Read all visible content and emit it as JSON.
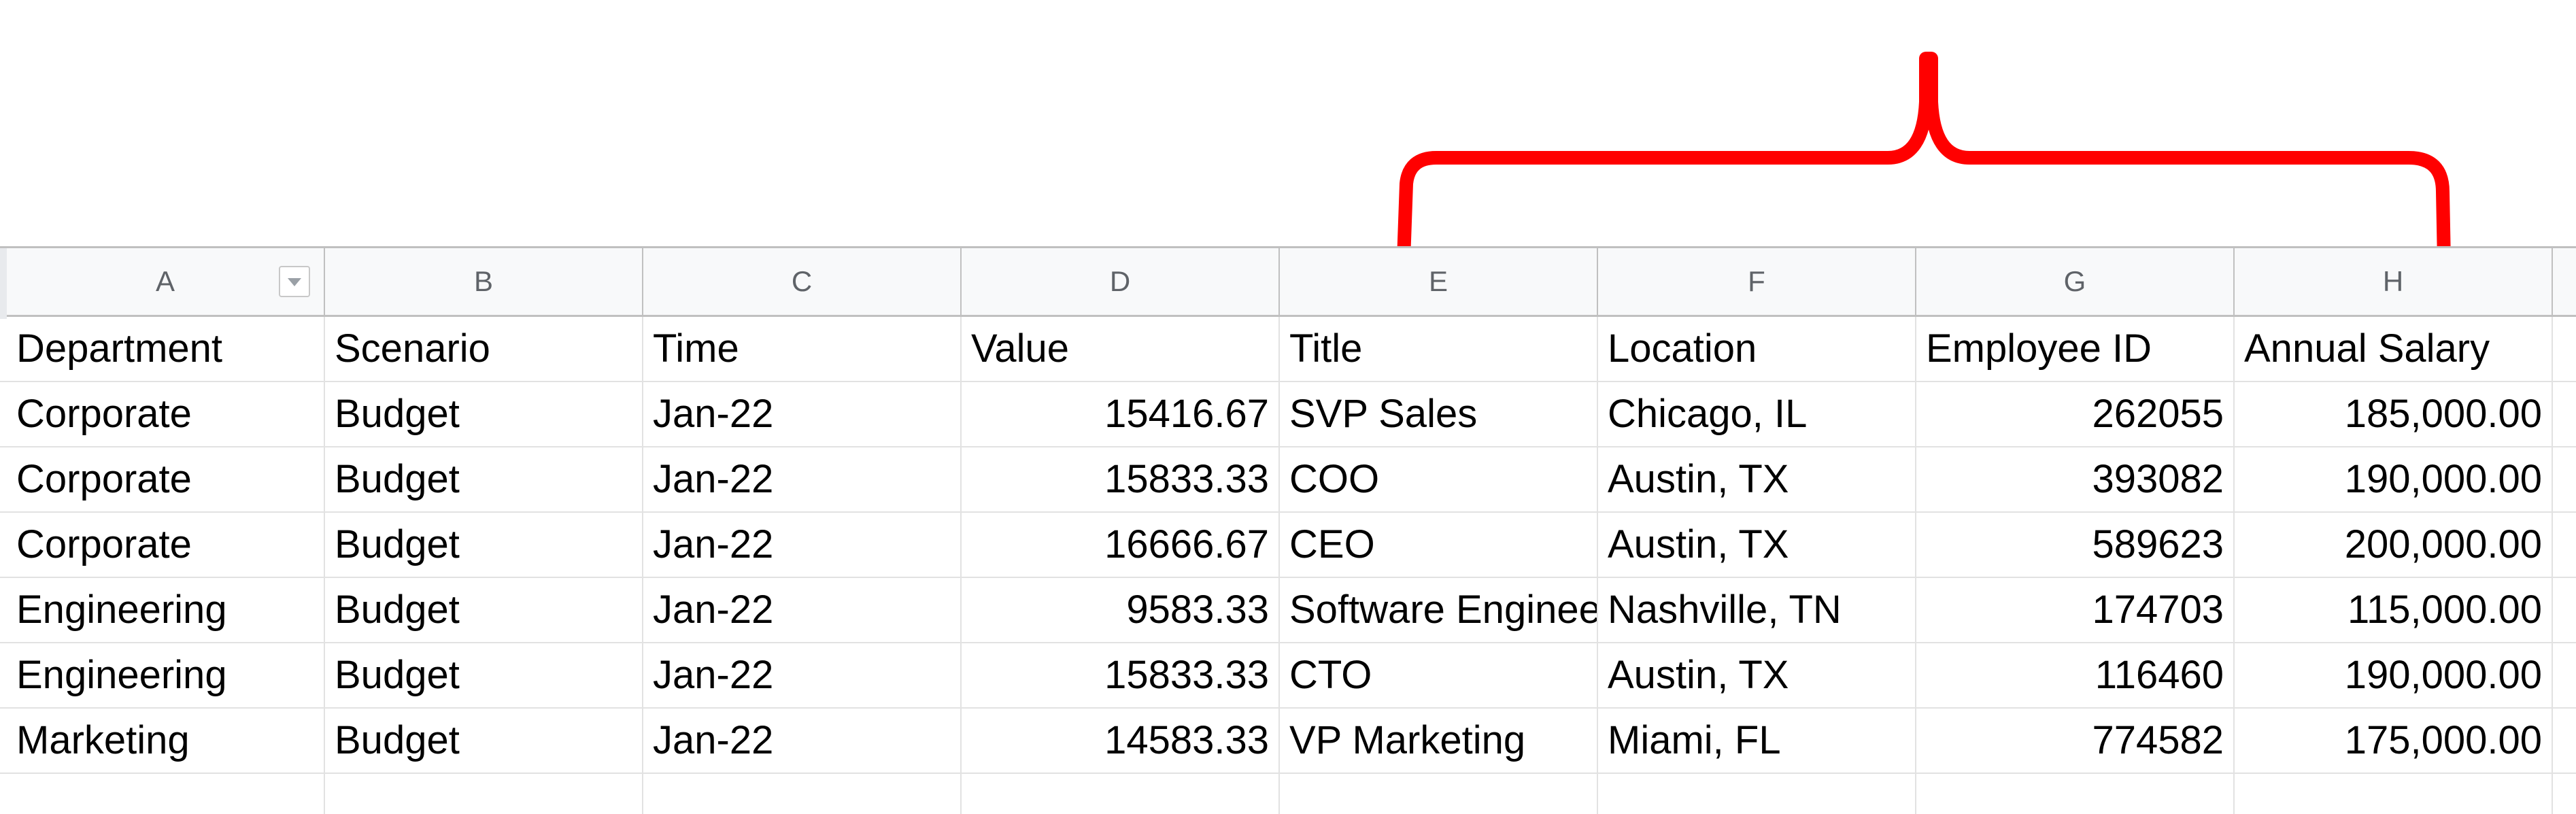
{
  "annotation": {
    "color": "#ff0000"
  },
  "columns": [
    "A",
    "B",
    "C",
    "D",
    "E",
    "F",
    "G",
    "H"
  ],
  "rows": [
    [
      "Department",
      "Scenario",
      "Time",
      "Value",
      "Title",
      "Location",
      "Employee ID",
      "Annual Salary"
    ],
    [
      "Corporate",
      "Budget",
      "Jan-22",
      "15416.67",
      "SVP Sales",
      "Chicago, IL",
      "262055",
      "185,000.00"
    ],
    [
      "Corporate",
      "Budget",
      "Jan-22",
      "15833.33",
      "COO",
      "Austin, TX",
      "393082",
      "190,000.00"
    ],
    [
      "Corporate",
      "Budget",
      "Jan-22",
      "16666.67",
      "CEO",
      "Austin, TX",
      "589623",
      "200,000.00"
    ],
    [
      "Engineering",
      "Budget",
      "Jan-22",
      "9583.33",
      "Software Engineer",
      "Nashville, TN",
      "174703",
      "115,000.00"
    ],
    [
      "Engineering",
      "Budget",
      "Jan-22",
      "15833.33",
      "CTO",
      "Austin, TX",
      "116460",
      "190,000.00"
    ],
    [
      "Marketing",
      "Budget",
      "Jan-22",
      "14583.33",
      "VP Marketing",
      "Miami, FL",
      "774582",
      "175,000.00"
    ],
    [
      "",
      "",
      "",
      "",
      "",
      "",
      "",
      ""
    ]
  ]
}
